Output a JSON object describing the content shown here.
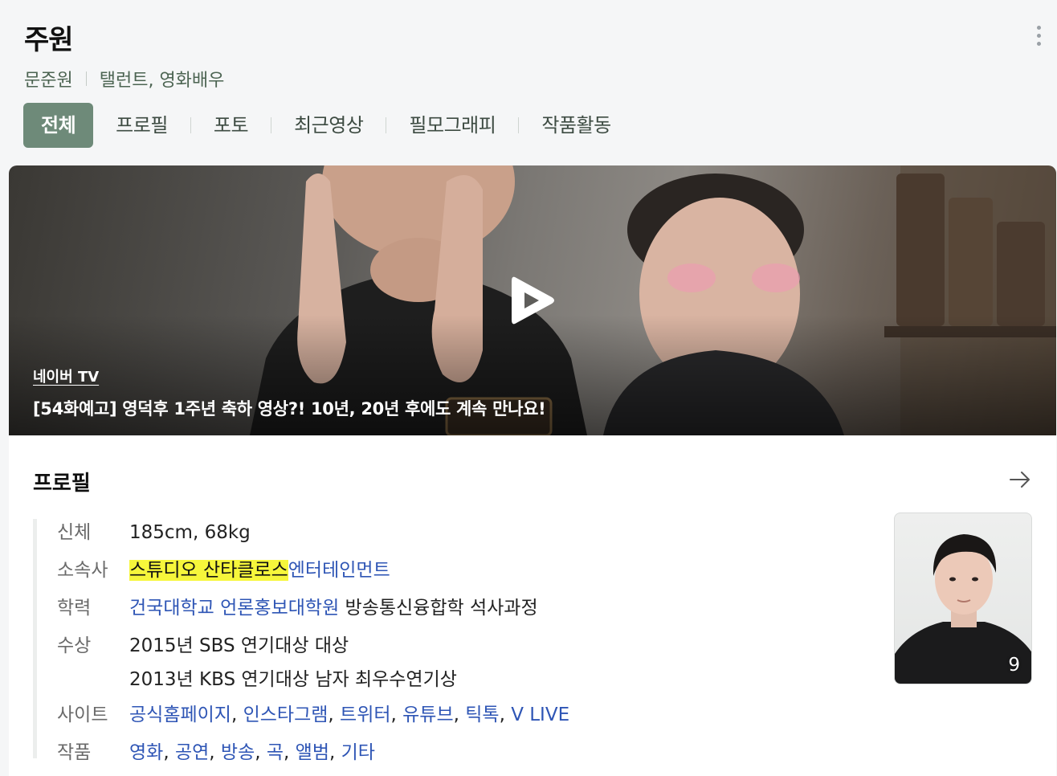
{
  "header": {
    "title": "주원",
    "real_name": "문준원",
    "occupation": "탤런트, 영화배우"
  },
  "tabs": [
    {
      "label": "전체",
      "active": true
    },
    {
      "label": "프로필",
      "active": false
    },
    {
      "label": "포토",
      "active": false
    },
    {
      "label": "최근영상",
      "active": false
    },
    {
      "label": "필모그래피",
      "active": false
    },
    {
      "label": "작품활동",
      "active": false
    }
  ],
  "video": {
    "source": "네이버 TV",
    "title": "[54화예고] 영덕후 1주년 축하 영상?! 10년, 20년 후에도 계속 만나요!",
    "play_icon": "play-icon"
  },
  "profile": {
    "title": "프로필",
    "arrow_icon": "arrow-right-icon",
    "body": {
      "label": "신체",
      "value": "185cm, 68kg"
    },
    "agency": {
      "label": "소속사",
      "highlight": "스튜디오 산타클로스",
      "link_rest": "엔터테인먼트"
    },
    "education": {
      "label": "학력",
      "link": "건국대학교 언론홍보대학원",
      "rest": " 방송통신융합학 석사과정"
    },
    "awards": {
      "label": "수상",
      "items": [
        "2015년 SBS 연기대상 대상",
        "2013년 KBS 연기대상 남자 최우수연기상"
      ]
    },
    "sites": {
      "label": "사이트",
      "links": [
        "공식홈페이지",
        "인스타그램",
        "트위터",
        "유튜브",
        "틱톡",
        "V LIVE"
      ]
    },
    "works": {
      "label": "작품",
      "links": [
        "영화",
        "공연",
        "방송",
        "곡",
        "앨범",
        "기타"
      ]
    },
    "photo_count": "9"
  },
  "colors": {
    "accent_tab": "#6e8a79",
    "subtitle": "#4c6452",
    "link": "#2e55b5",
    "highlight": "#f6f63b"
  }
}
